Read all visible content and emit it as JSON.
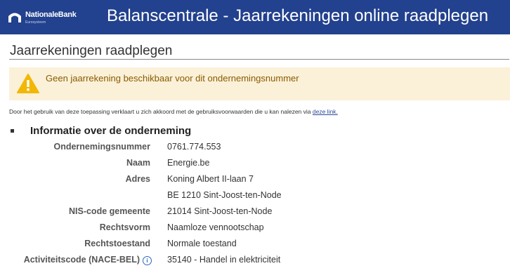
{
  "header": {
    "logo_text": "NationaleBank",
    "logo_sub": "Eurosysteem",
    "title": "Balanscentrale - Jaarrekeningen online raadplegen"
  },
  "page_title": "Jaarrekeningen raadplegen",
  "alert": {
    "icon": "warning-icon",
    "message": "Geen jaarrekening beschikbaar voor dit ondernemingsnummer"
  },
  "disclaimer": {
    "text": "Door het gebruik van deze toepassing verklaart u zich akkoord met de gebruiksvoorwaarden die u kan nalezen via",
    "link_label": "deze link."
  },
  "section": {
    "heading": "Informatie over de onderneming",
    "rows": [
      {
        "label": "Ondernemingsnummer",
        "value": "0761.774.553"
      },
      {
        "label": "Naam",
        "value": "Energie.be"
      },
      {
        "label": "Adres",
        "value": "Koning Albert II-laan 7"
      },
      {
        "label": "",
        "value": "BE 1210 Sint-Joost-ten-Node"
      },
      {
        "label": "NIS-code gemeente",
        "value": "21014 Sint-Joost-ten-Node"
      },
      {
        "label": "Rechtsvorm",
        "value": "Naamloze vennootschap"
      },
      {
        "label": "Rechtstoestand",
        "value": "Normale toestand"
      },
      {
        "label": "Activiteitscode (NACE-BEL)",
        "value": "35140 - Handel in elektriciteit"
      }
    ]
  },
  "colors": {
    "header_bg": "#22418e",
    "alert_bg": "#fbf1d9",
    "warning_yellow": "#f2b705",
    "link": "#2a4a9a"
  }
}
